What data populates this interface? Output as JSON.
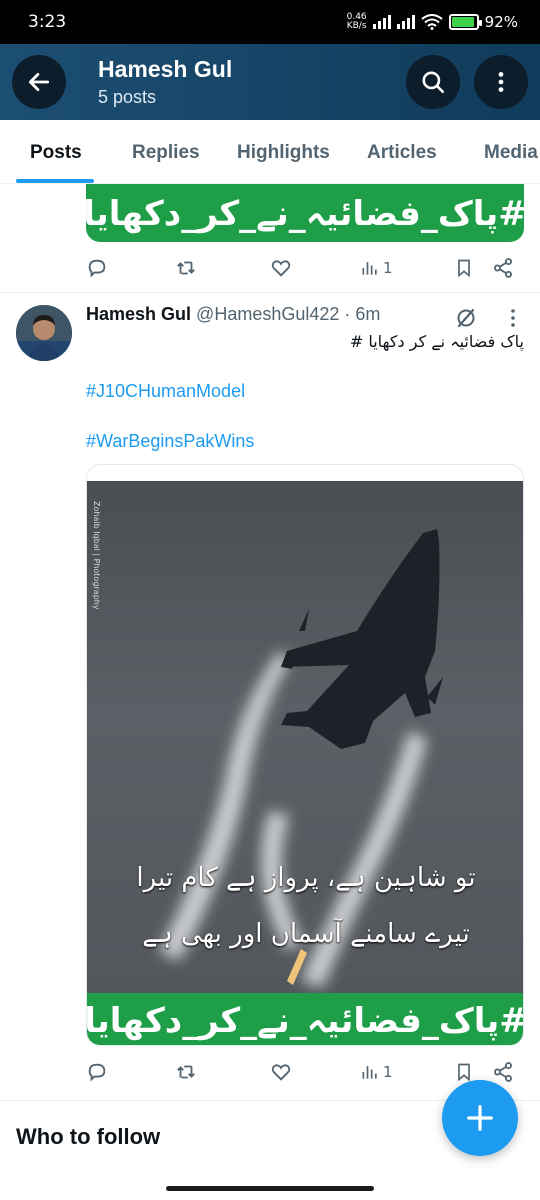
{
  "status_bar": {
    "time": "3:23",
    "net_speed_value": "0.46",
    "net_speed_unit": "KB/s",
    "battery_percent": "92%",
    "battery_level": 0.92
  },
  "header": {
    "name": "Hamesh Gul",
    "post_count": "5 posts",
    "back_icon": "back-arrow-icon",
    "search_icon": "search-icon",
    "more_icon": "more-vertical-icon"
  },
  "tabs": [
    "Posts",
    "Replies",
    "Highlights",
    "Articles",
    "Media"
  ],
  "active_tab": "Posts",
  "previous_post": {
    "banner_text": "#پاک_فضائیہ_نے_کر_دکھایا",
    "views": "1"
  },
  "tweet": {
    "author_name": "Hamesh Gul",
    "handle": "@HameshGul422",
    "time": "· 6m",
    "text": "پاک فضائیہ نے کر دکھایا #",
    "hashtags": [
      "#J10CHumanModel",
      "#WarBeginsPakWins"
    ],
    "media": {
      "credit": "Zohaib Iqbal | Photography",
      "poetry_line1": "تو شاہین ہے، پرواز ہے کام تیرا",
      "poetry_line2": "تیرے سامنے آسماں اور بھی ہے",
      "banner_text": "#پاک_فضائیہ_نے_کر_دکھایا"
    },
    "views": "1"
  },
  "who_to_follow": "Who to follow",
  "colors": {
    "accent": "#1d9bf0",
    "banner_green": "#1f9e48",
    "header_blue": "#1c4e73"
  }
}
